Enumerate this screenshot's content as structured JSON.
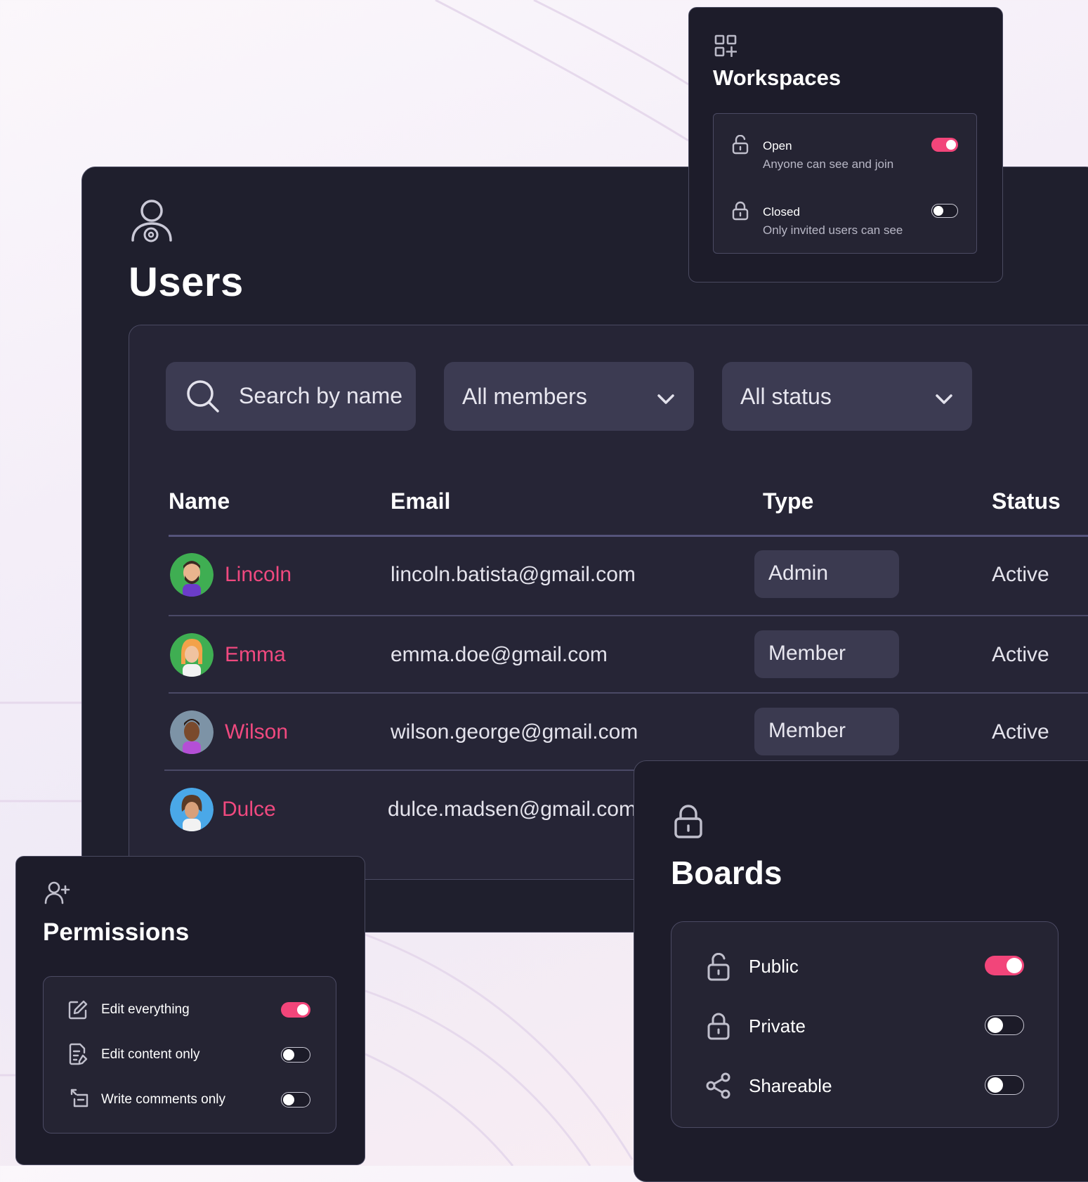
{
  "colors": {
    "accent": "#f2457a",
    "name_text": "#f0497f",
    "panel_bg": "#1e1e2c",
    "pill_bg": "#3b3a50"
  },
  "users": {
    "icon": "user-settings-icon",
    "title": "Users",
    "filters": {
      "search_placeholder": "Search by name",
      "members_value": "All members",
      "status_value": "All status"
    },
    "columns": [
      "Name",
      "Email",
      "Type",
      "Status"
    ],
    "rows": [
      {
        "name": "Lincoln",
        "email": "lincoln.batista@gmail.com",
        "type": "Admin",
        "status": "Active"
      },
      {
        "name": "Emma",
        "email": "emma.doe@gmail.com",
        "type": "Member",
        "status": "Active"
      },
      {
        "name": "Wilson",
        "email": "wilson.george@gmail.com",
        "type": "Member",
        "status": "Active"
      },
      {
        "name": "Dulce",
        "email": "dulce.madsen@gmail.com",
        "type": "",
        "status": ""
      }
    ]
  },
  "workspaces": {
    "icon": "grid-add-icon",
    "title": "Workspaces",
    "options": [
      {
        "label": "Open",
        "sub": "Anyone can see and join",
        "icon": "unlock-icon",
        "on": true
      },
      {
        "label": "Closed",
        "sub": "Only invited users can see",
        "icon": "lock-icon",
        "on": false
      }
    ]
  },
  "permissions": {
    "icon": "user-add-icon",
    "title": "Permissions",
    "options": [
      {
        "label": "Edit everything",
        "icon": "edit-icon",
        "on": true
      },
      {
        "label": "Edit content only",
        "icon": "document-edit-icon",
        "on": false
      },
      {
        "label": "Write comments only",
        "icon": "comment-icon",
        "on": false
      }
    ]
  },
  "boards": {
    "icon": "lock-icon",
    "title": "Boards",
    "options": [
      {
        "label": "Public",
        "icon": "unlock-icon",
        "on": true
      },
      {
        "label": "Private",
        "icon": "lock-icon",
        "on": false
      },
      {
        "label": "Shareable",
        "icon": "share-icon",
        "on": false
      }
    ]
  }
}
